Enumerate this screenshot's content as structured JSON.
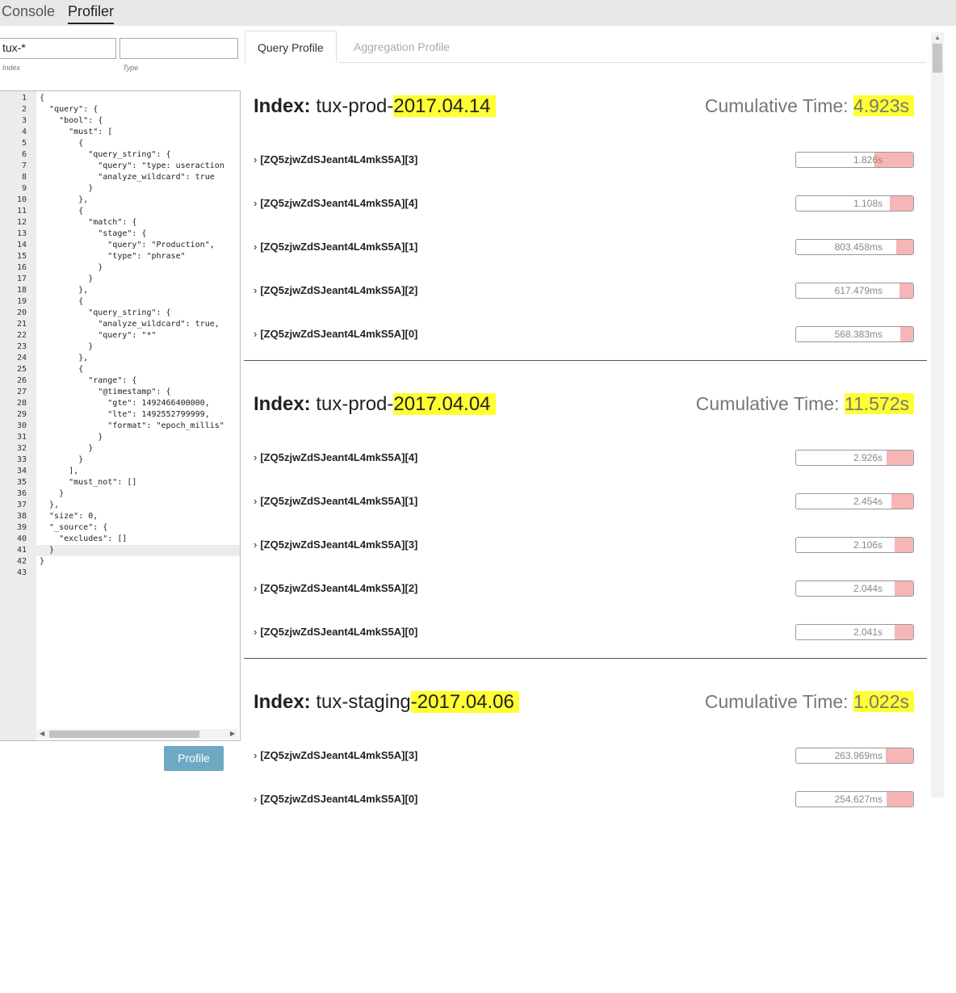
{
  "top_tabs": [
    {
      "label": "Console",
      "active": false
    },
    {
      "label": "Profiler",
      "active": true
    }
  ],
  "index_input": {
    "value": "tux-*",
    "label": "Index"
  },
  "type_input": {
    "value": "",
    "label": "Type"
  },
  "editor": {
    "active_line": 41,
    "lines": [
      "{",
      "  \"query\": {",
      "    \"bool\": {",
      "      \"must\": [",
      "        {",
      "          \"query_string\": {",
      "            \"query\": \"type: useraction",
      "            \"analyze_wildcard\": true",
      "          }",
      "        },",
      "        {",
      "          \"match\": {",
      "            \"stage\": {",
      "              \"query\": \"Production\",",
      "              \"type\": \"phrase\"",
      "            }",
      "          }",
      "        },",
      "        {",
      "          \"query_string\": {",
      "            \"analyze_wildcard\": true,",
      "            \"query\": \"*\"",
      "          }",
      "        },",
      "        {",
      "          \"range\": {",
      "            \"@timestamp\": {",
      "              \"gte\": 1492466400000,",
      "              \"lte\": 1492552799999,",
      "              \"format\": \"epoch_millis\"",
      "            }",
      "          }",
      "        }",
      "      ],",
      "      \"must_not\": []",
      "    }",
      "  },",
      "  \"size\": 0,",
      "  \"_source\": {",
      "    \"excludes\": []",
      "  }",
      "}",
      ""
    ]
  },
  "profile_button": "Profile",
  "result_tabs": [
    {
      "label": "Query Profile",
      "active": true
    },
    {
      "label": "Aggregation Profile",
      "active": false
    }
  ],
  "index_label": "Index:",
  "cumulative_label": "Cumulative Time:",
  "sections": [
    {
      "index_prefix": "tux-prod-",
      "index_hl": "2017.04.14",
      "cum_time": "4.923s",
      "shards": [
        {
          "name": "[ZQ5zjwZdSJeant4L4mkS5A][3]",
          "time": "1.826s",
          "fraction": 0.37
        },
        {
          "name": "[ZQ5zjwZdSJeant4L4mkS5A][4]",
          "time": "1.108s",
          "fraction": 0.22
        },
        {
          "name": "[ZQ5zjwZdSJeant4L4mkS5A][1]",
          "time": "803.458ms",
          "fraction": 0.16
        },
        {
          "name": "[ZQ5zjwZdSJeant4L4mkS5A][2]",
          "time": "617.479ms",
          "fraction": 0.13
        },
        {
          "name": "[ZQ5zjwZdSJeant4L4mkS5A][0]",
          "time": "568.383ms",
          "fraction": 0.12
        }
      ]
    },
    {
      "index_prefix": "tux-prod-",
      "index_hl": "2017.04.04",
      "cum_time": "11.572s",
      "shards": [
        {
          "name": "[ZQ5zjwZdSJeant4L4mkS5A][4]",
          "time": "2.926s",
          "fraction": 0.25
        },
        {
          "name": "[ZQ5zjwZdSJeant4L4mkS5A][1]",
          "time": "2.454s",
          "fraction": 0.21
        },
        {
          "name": "[ZQ5zjwZdSJeant4L4mkS5A][3]",
          "time": "2.106s",
          "fraction": 0.18
        },
        {
          "name": "[ZQ5zjwZdSJeant4L4mkS5A][2]",
          "time": "2.044s",
          "fraction": 0.18
        },
        {
          "name": "[ZQ5zjwZdSJeant4L4mkS5A][0]",
          "time": "2.041s",
          "fraction": 0.18
        }
      ]
    },
    {
      "index_prefix": "tux-staging",
      "index_hl": "-2017.04.06",
      "cum_time": "1.022s",
      "shards": [
        {
          "name": "[ZQ5zjwZdSJeant4L4mkS5A][3]",
          "time": "263.969ms",
          "fraction": 0.26
        },
        {
          "name": "[ZQ5zjwZdSJeant4L4mkS5A][0]",
          "time": "254.627ms",
          "fraction": 0.25
        }
      ]
    }
  ],
  "colors": {
    "highlight": "#ffff33",
    "bar_fill": "#f7b6b6",
    "profile_button": "#6ea9c4"
  }
}
